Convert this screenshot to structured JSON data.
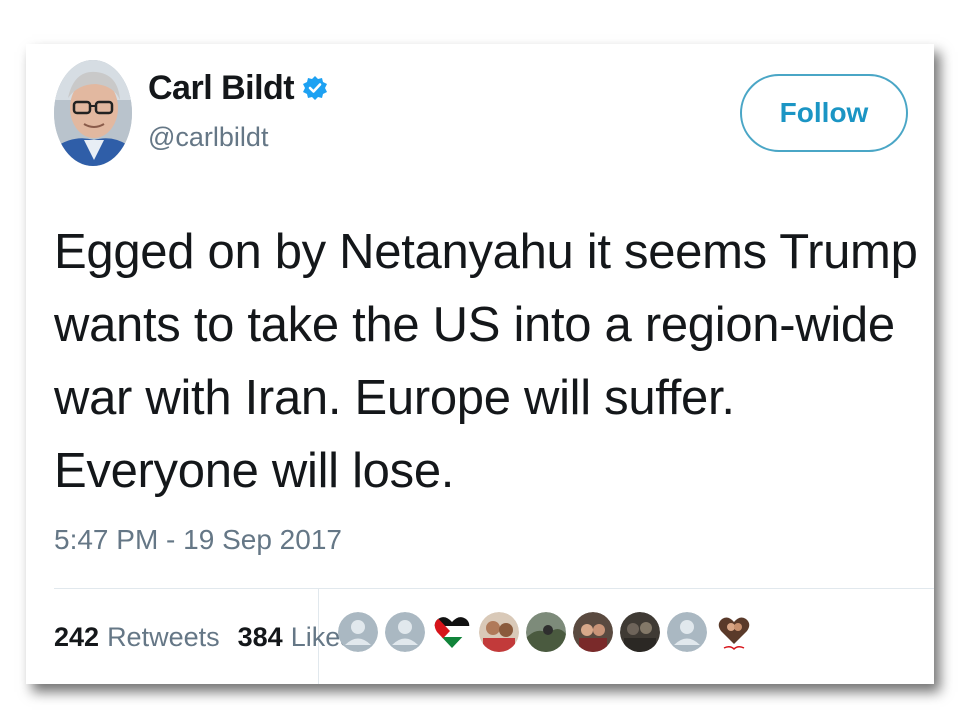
{
  "account": {
    "display_name": "Carl Bildt",
    "handle": "@carlbildt",
    "verified": true,
    "verified_icon": "verified-badge-icon"
  },
  "follow_button": {
    "label": "Follow"
  },
  "tweet": {
    "text": "Egged on by Netanyahu it seems Trump wants to take the US into a region-wide war with Iran. Europe will suffer. Everyone will lose.",
    "timestamp": "5:47 PM - 19 Sep 2017"
  },
  "stats": {
    "retweets_count": "242",
    "retweets_label": "Retweets",
    "likes_count": "384",
    "likes_label": "Likes"
  },
  "likers": [
    {
      "type": "default-avatar"
    },
    {
      "type": "default-avatar"
    },
    {
      "type": "flag-heart"
    },
    {
      "type": "photo"
    },
    {
      "type": "photo"
    },
    {
      "type": "photo"
    },
    {
      "type": "photo"
    },
    {
      "type": "default-avatar"
    },
    {
      "type": "photo-heart"
    }
  ],
  "colors": {
    "accent": "#1da1f2",
    "follow_border": "#4aa6c6",
    "text_primary": "#14171a",
    "text_secondary": "#657786"
  }
}
